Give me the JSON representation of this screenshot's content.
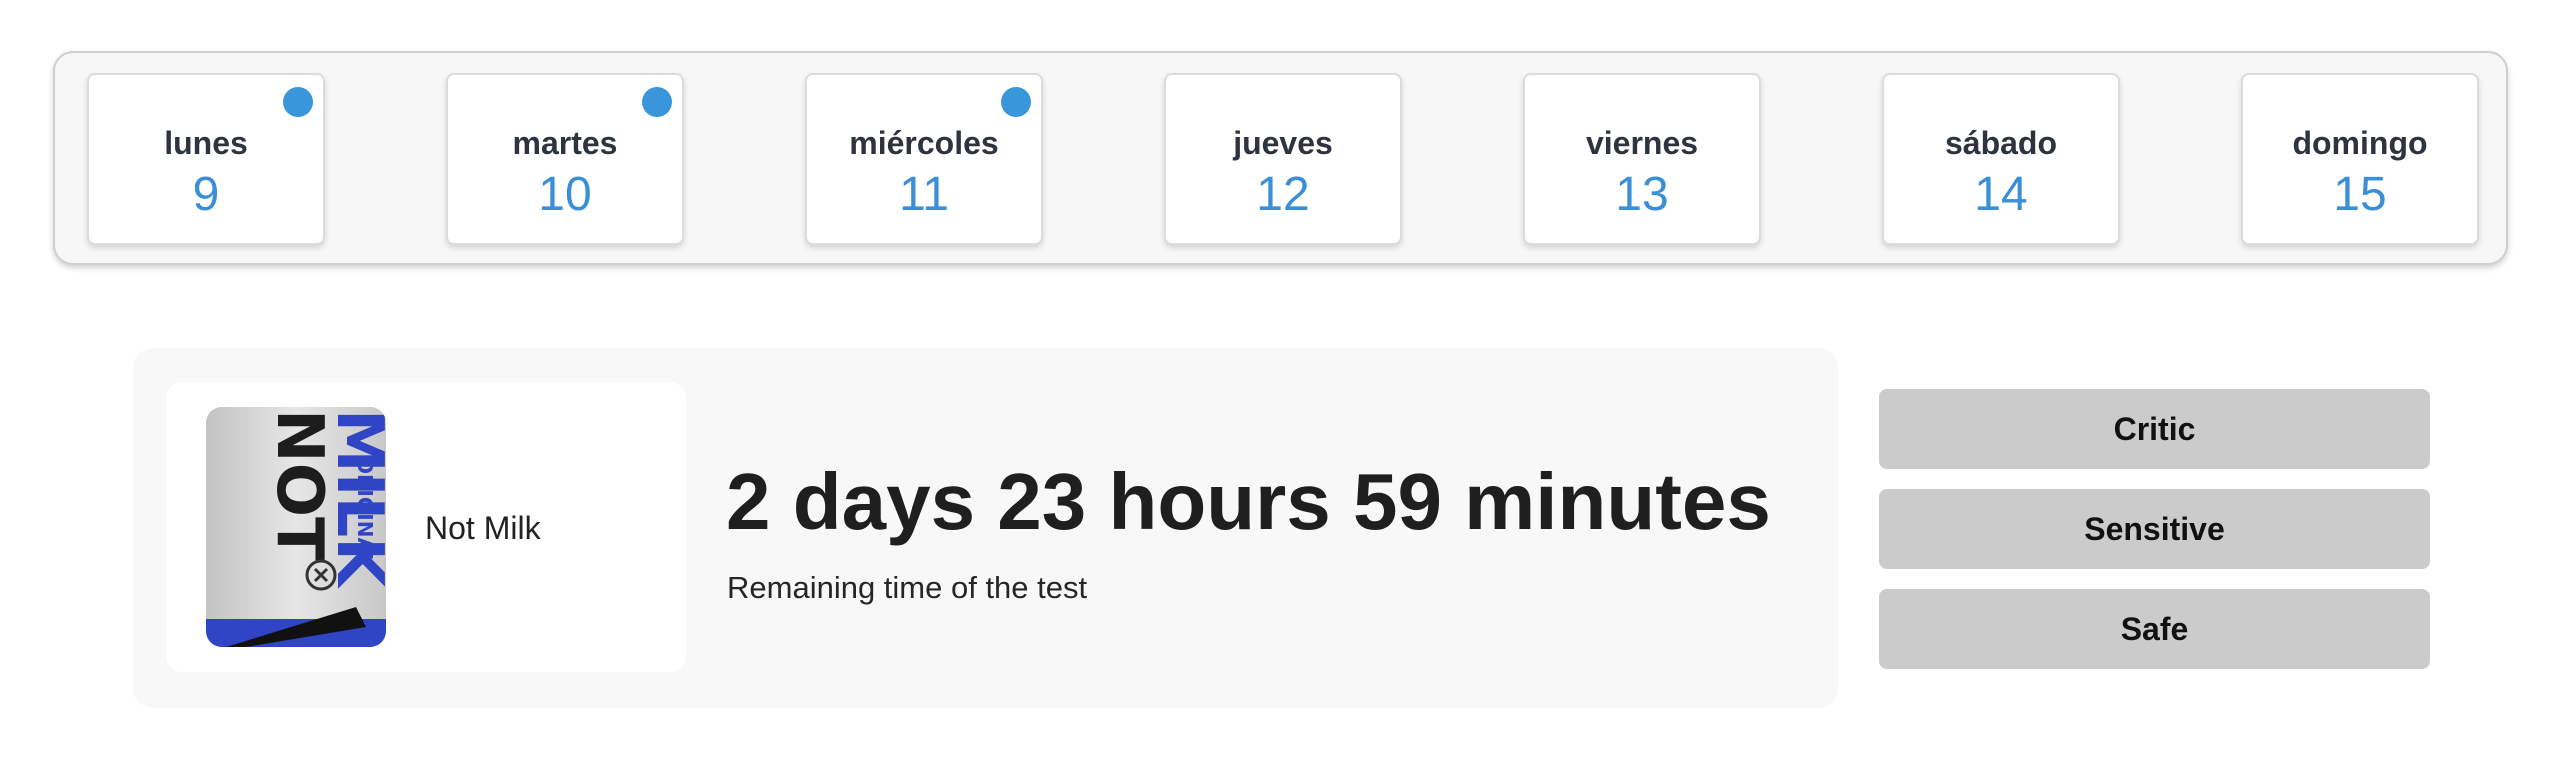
{
  "week": {
    "days": [
      {
        "name": "lunes",
        "number": "9",
        "has_event": true
      },
      {
        "name": "martes",
        "number": "10",
        "has_event": true
      },
      {
        "name": "miércoles",
        "number": "11",
        "has_event": true
      },
      {
        "name": "jueves",
        "number": "12",
        "has_event": false
      },
      {
        "name": "viernes",
        "number": "13",
        "has_event": false
      },
      {
        "name": "sábado",
        "number": "14",
        "has_event": false
      },
      {
        "name": "domingo",
        "number": "15",
        "has_event": false
      }
    ],
    "dot_color": "#3a96db"
  },
  "test": {
    "product_name": "Not Milk",
    "product_image_text": {
      "top": "NOT",
      "main": "MILK",
      "sub": "ORIGINAL"
    },
    "remaining_time": "2 days 23 hours 59 minutes",
    "remaining_caption": "Remaining time of the test"
  },
  "actions": {
    "critic_label": "Critic",
    "sensitive_label": "Sensitive",
    "safe_label": "Safe"
  },
  "colors": {
    "accent": "#3a8fd6",
    "button_bg": "#cbcbcb"
  }
}
